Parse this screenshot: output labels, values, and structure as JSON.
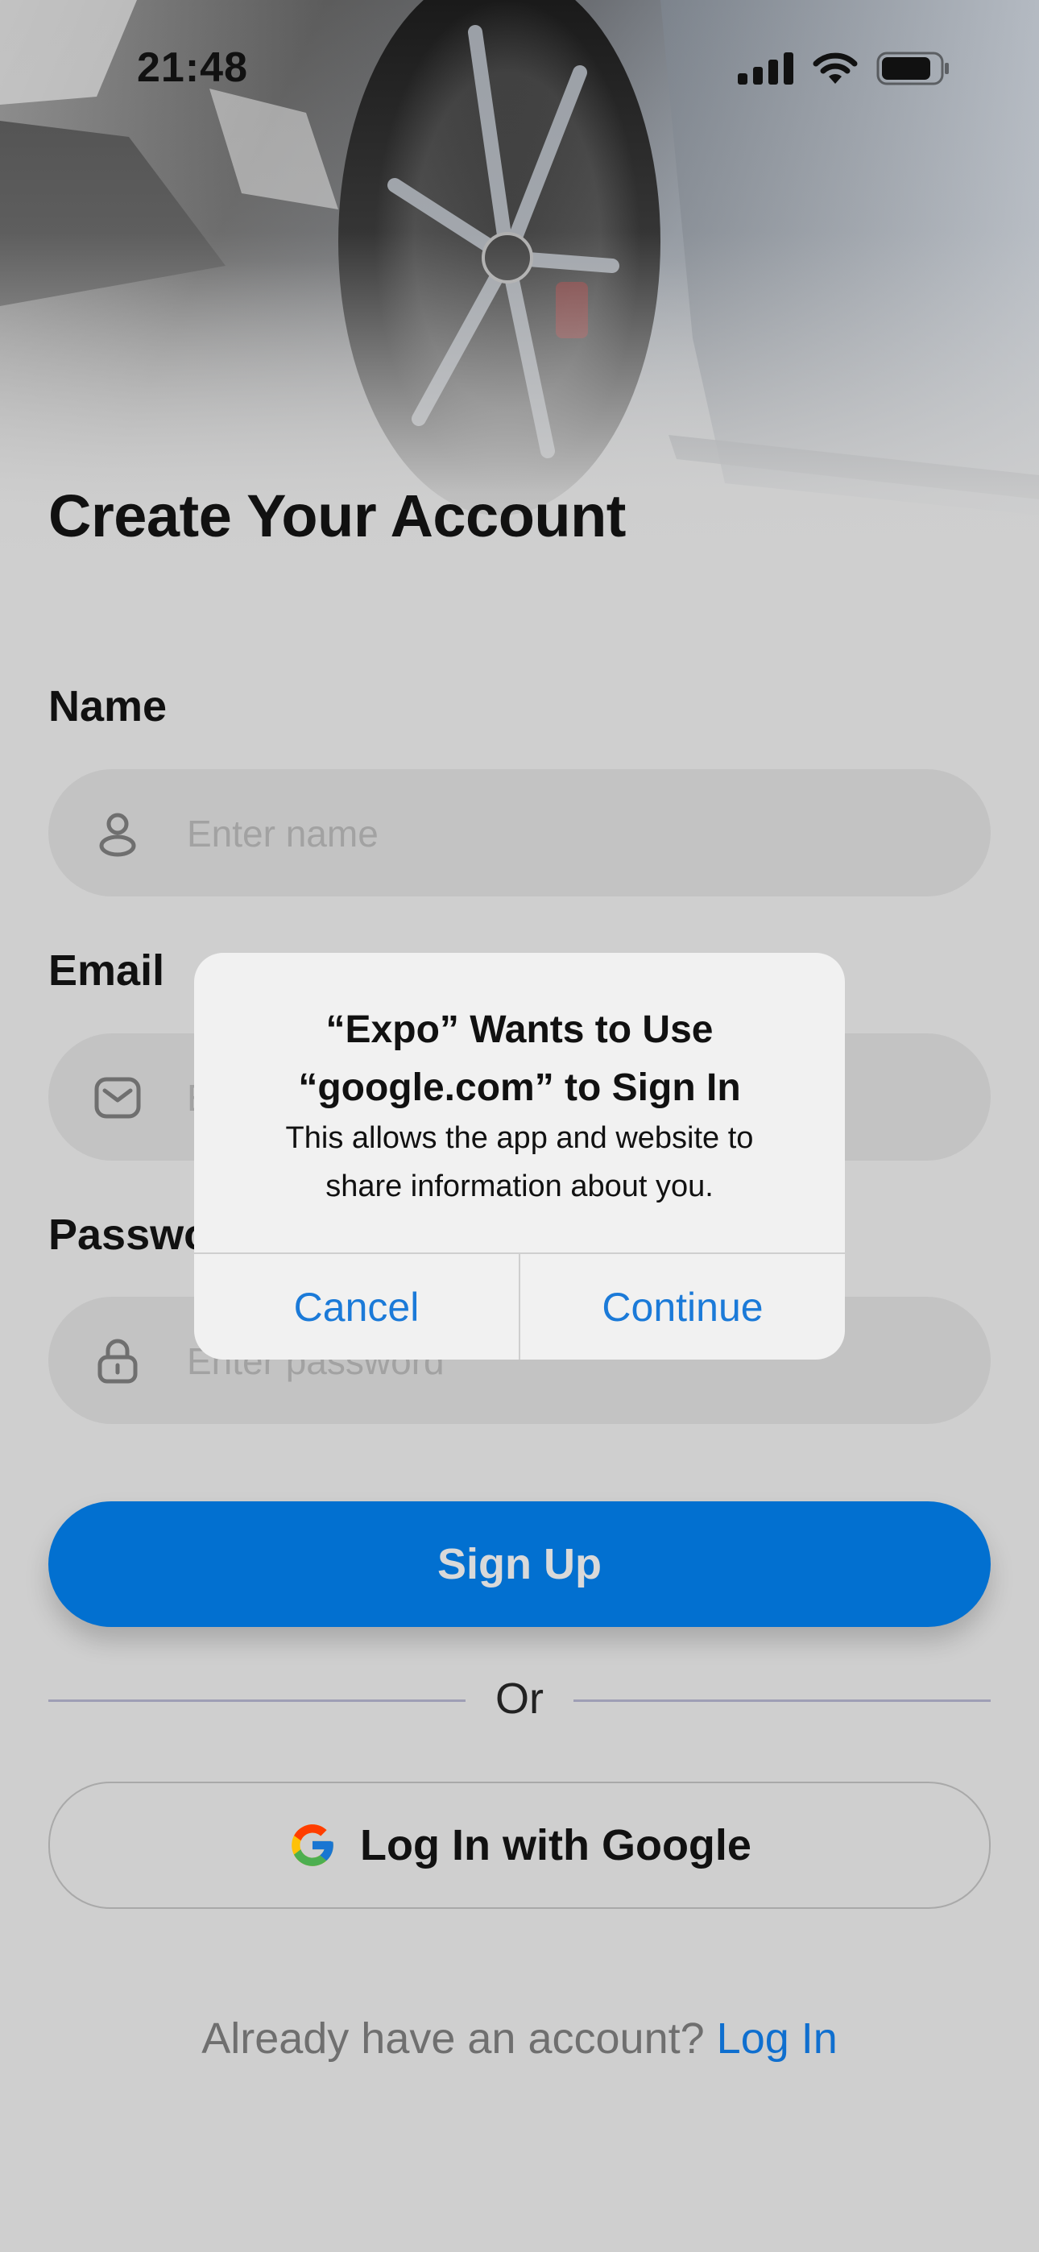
{
  "status_bar": {
    "time": "21:48",
    "battery_level": 0.85
  },
  "screen": {
    "title": "Create Your Account",
    "fields": [
      {
        "label": "Name",
        "placeholder": "Enter name",
        "value": "",
        "icon": "user-icon"
      },
      {
        "label": "Email",
        "placeholder": "Enter email",
        "value": "",
        "icon": "mail-icon"
      },
      {
        "label": "Password",
        "placeholder": "Enter password",
        "value": "",
        "icon": "lock-icon"
      }
    ],
    "signup_button": "Sign Up",
    "divider": "Or",
    "google_button": {
      "label": "Log In with Google",
      "icon": "google-icon"
    },
    "footer_text": "Already have an account?",
    "footer_link": "Log In"
  },
  "dialog": {
    "title_line1": "“Expo” Wants to Use",
    "title_line2": "“google.com” to Sign In",
    "message_line1": "This allows the app and website to",
    "message_line2": "share information about you.",
    "cancel": "Cancel",
    "continue": "Continue"
  },
  "colors": {
    "primary": "#0270d0",
    "link": "#0f6fcf",
    "dialog_action": "#1b7ad8",
    "background": "#cfcfcf"
  }
}
